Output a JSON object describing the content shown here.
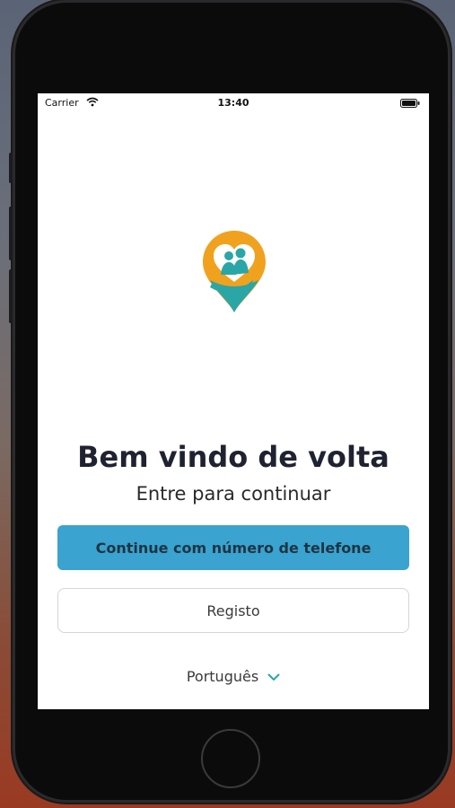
{
  "status_bar": {
    "carrier": "Carrier",
    "time": "13:40"
  },
  "welcome": {
    "title": "Bem vindo de volta",
    "subtitle": "Entre para continuar"
  },
  "actions": {
    "phone_login_label": "Continue com número de telefone",
    "register_label": "Registo"
  },
  "language": {
    "selected": "Português"
  },
  "colors": {
    "primary_button": "#3aa3cf",
    "logo_orange": "#f0a21e",
    "logo_teal": "#2aa6a6"
  },
  "icons": [
    "wifi-icon",
    "battery-icon",
    "app-logo-icon",
    "chevron-down-icon"
  ]
}
